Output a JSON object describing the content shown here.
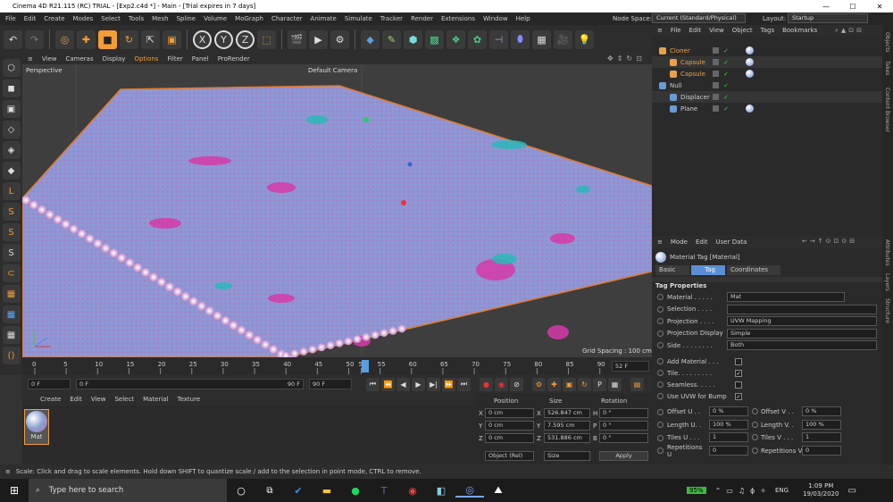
{
  "window": {
    "title": "Cinema 4D R21.115 (RC) TRIAL - [Exp2.c4d *] - Main - [Trial expires in 7 days]",
    "min": "—",
    "max": "☐",
    "close": "✕"
  },
  "menu": [
    "File",
    "Edit",
    "Create",
    "Modes",
    "Select",
    "Tools",
    "Mesh",
    "Spline",
    "Volume",
    "MoGraph",
    "Character",
    "Animate",
    "Simulate",
    "Tracker",
    "Render",
    "Extensions",
    "Window",
    "Help"
  ],
  "nodespace": {
    "label": "Node Space:",
    "value": "Current (Standard/Physical)",
    "layout_label": "Layout:",
    "layout_value": "Startup"
  },
  "viewport": {
    "menu": [
      "View",
      "Cameras",
      "Display",
      "Options",
      "Filter",
      "Panel",
      "ProRender"
    ],
    "name": "Perspective",
    "camera": "Default Camera",
    "grid": "Grid Spacing : 100 cm"
  },
  "timeline": {
    "ticks": [
      "0",
      "5",
      "10",
      "15",
      "20",
      "25",
      "30",
      "35",
      "40",
      "45",
      "50",
      "52",
      "55",
      "60",
      "65",
      "70",
      "75",
      "80",
      "85",
      "90"
    ],
    "current": "52 F"
  },
  "transport": {
    "start": "0 F",
    "cur": "0 F",
    "end": "90 F",
    "end2": "90 F"
  },
  "materials": {
    "menu": [
      "Create",
      "Edit",
      "View",
      "Select",
      "Material",
      "Texture"
    ],
    "items": [
      "Mat"
    ]
  },
  "coords": {
    "headers": [
      "Position",
      "Size",
      "Rotation"
    ],
    "rows": [
      {
        "a": "X",
        "p": "0 cm",
        "s": "526.847 cm",
        "r": "H",
        "rv": "0 °"
      },
      {
        "a": "Y",
        "p": "0 cm",
        "s": "7.595 cm",
        "r": "P",
        "rv": "0 °"
      },
      {
        "a": "Z",
        "p": "0 cm",
        "s": "531.886 cm",
        "r": "B",
        "rv": "0 °"
      }
    ],
    "mode": "Object (Rel)",
    "size": "Size",
    "apply": "Apply"
  },
  "objects": {
    "menu": [
      "File",
      "Edit",
      "View",
      "Object",
      "Tags",
      "Bookmarks"
    ],
    "tree": [
      {
        "name": "Cloner",
        "indent": 0,
        "color": "#e8a04a"
      },
      {
        "name": "Capsule",
        "indent": 1,
        "color": "#e8a04a"
      },
      {
        "name": "Capsule",
        "indent": 1,
        "color": "#e8a04a"
      },
      {
        "name": "Null",
        "indent": 0,
        "color": "#ccc"
      },
      {
        "name": "Displacer",
        "indent": 1,
        "color": "#ccc"
      },
      {
        "name": "Plane",
        "indent": 1,
        "color": "#ccc"
      }
    ]
  },
  "attributes": {
    "menu": [
      "Mode",
      "Edit",
      "User Data"
    ],
    "title": "Material Tag [Material]",
    "tabs": [
      "Basic",
      "Tag",
      "Coordinates"
    ],
    "section": "Tag Properties",
    "props": [
      {
        "label": "Material . . . . .",
        "value": "Mat"
      },
      {
        "label": "Selection . . . .",
        "value": ""
      },
      {
        "label": "Projection . . . .",
        "value": "UVW Mapping"
      },
      {
        "label": "Projection Display",
        "value": "Simple"
      },
      {
        "label": "Side . . . . . . . .",
        "value": "Both"
      }
    ],
    "checks": [
      {
        "label": "Add Material . . .",
        "checked": ""
      },
      {
        "label": "Tile. . . . . . . . .",
        "checked": "✓"
      },
      {
        "label": "Seamless. . . . .",
        "checked": ""
      },
      {
        "label": "Use UVW for Bump",
        "checked": "✓"
      }
    ],
    "offsets": [
      {
        "l1": "Offset U . .",
        "v1": "0 %",
        "l2": "Offset V . .",
        "v2": "0 %"
      },
      {
        "l1": "Length U. .",
        "v1": "100 %",
        "l2": "Length V. .",
        "v2": "100 %"
      },
      {
        "l1": "Tiles U . . .",
        "v1": "1",
        "l2": "Tiles V . . .",
        "v2": "1"
      },
      {
        "l1": "Repetitions U",
        "v1": "0",
        "l2": "Repetitions V",
        "v2": "0"
      }
    ]
  },
  "side_tabs": [
    "Objects",
    "Takes",
    "Content Browser",
    "Attributes",
    "Layers",
    "Structure"
  ],
  "status": "Scale: Click and drag to scale elements. Hold down SHIFT to quantize scale / add to the selection in point mode, CTRL to remove.",
  "taskbar": {
    "search": "Type here to search",
    "battery": "95%",
    "lang": "ENG",
    "time": "1:09 PM",
    "date": "19/03/2020"
  }
}
